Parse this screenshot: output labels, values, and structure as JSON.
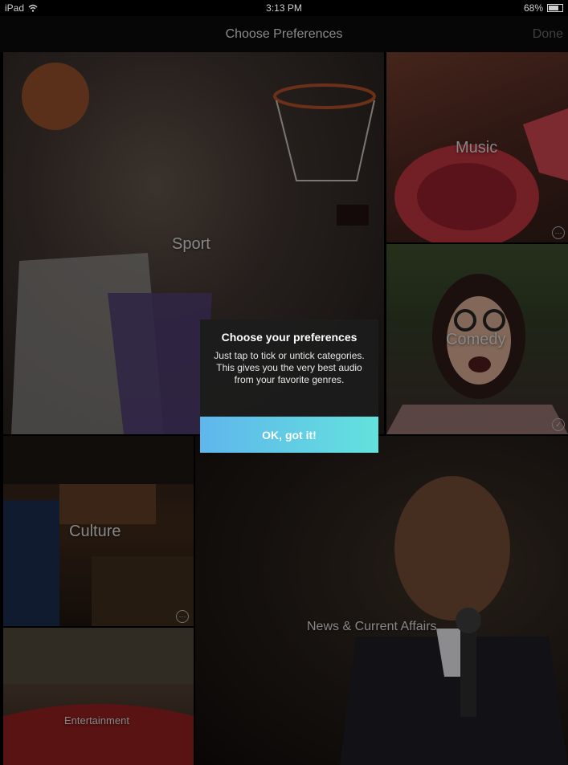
{
  "status_bar": {
    "device": "iPad",
    "time": "3:13 PM",
    "battery": "68%"
  },
  "nav": {
    "title": "Choose Preferences",
    "done_label": "Done"
  },
  "tiles": {
    "sport": {
      "label": "Sport"
    },
    "music": {
      "label": "Music"
    },
    "comedy": {
      "label": "Comedy"
    },
    "culture": {
      "label": "Culture"
    },
    "entertainment": {
      "label": "Entertainment"
    },
    "news": {
      "label": "News & Current Affairs"
    }
  },
  "popup": {
    "title": "Choose your preferences",
    "body": "Just tap to tick or untick categories. This gives you the very best audio from your favorite genres.",
    "button_label": "OK, got it!"
  },
  "colors": {
    "accent_gradient_start": "#5fb6ec",
    "accent_gradient_end": "#63e2dd"
  }
}
